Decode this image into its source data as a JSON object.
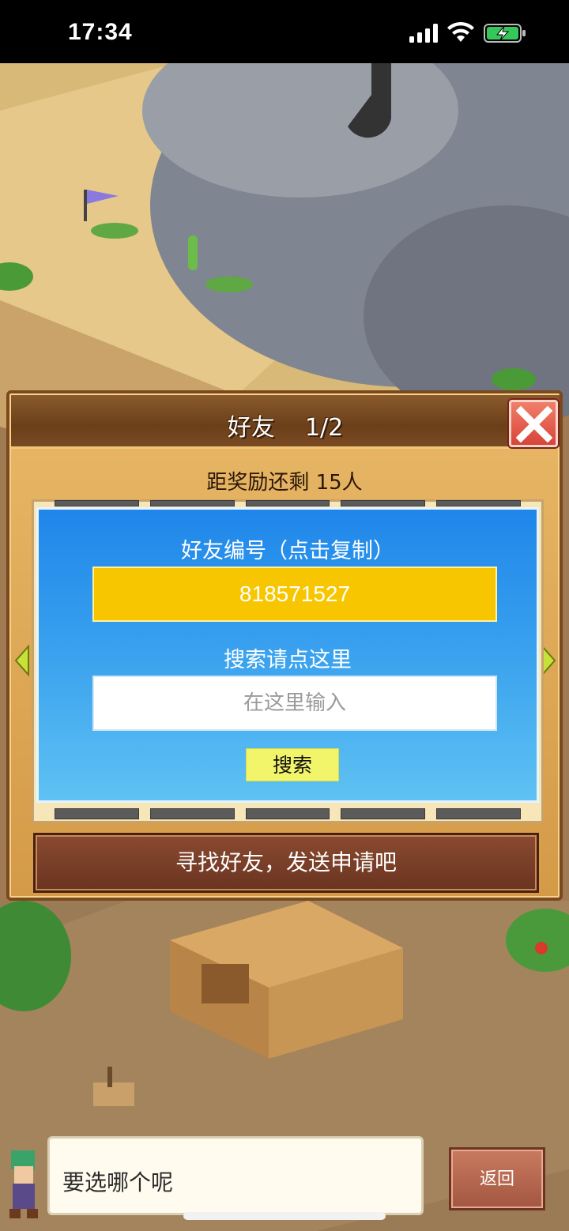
{
  "status_bar": {
    "time": "17:34"
  },
  "dialog": {
    "title": "好友    1/2",
    "remaining_text": "距奖励还剩 15人",
    "friend_id_label": "好友编号（点击复制）",
    "friend_id": "818571527",
    "search_label": "搜索请点这里",
    "search_placeholder": "在这里输入",
    "search_button": "搜索",
    "action_text": "寻找好友，发送申请吧"
  },
  "bottom": {
    "message": "要选哪个呢",
    "back_button": "返回"
  },
  "colors": {
    "panel_blue": "#1f86ea",
    "id_box_yellow": "#f7c600",
    "search_button": "#f2f56a",
    "close_red": "#d8443a"
  }
}
